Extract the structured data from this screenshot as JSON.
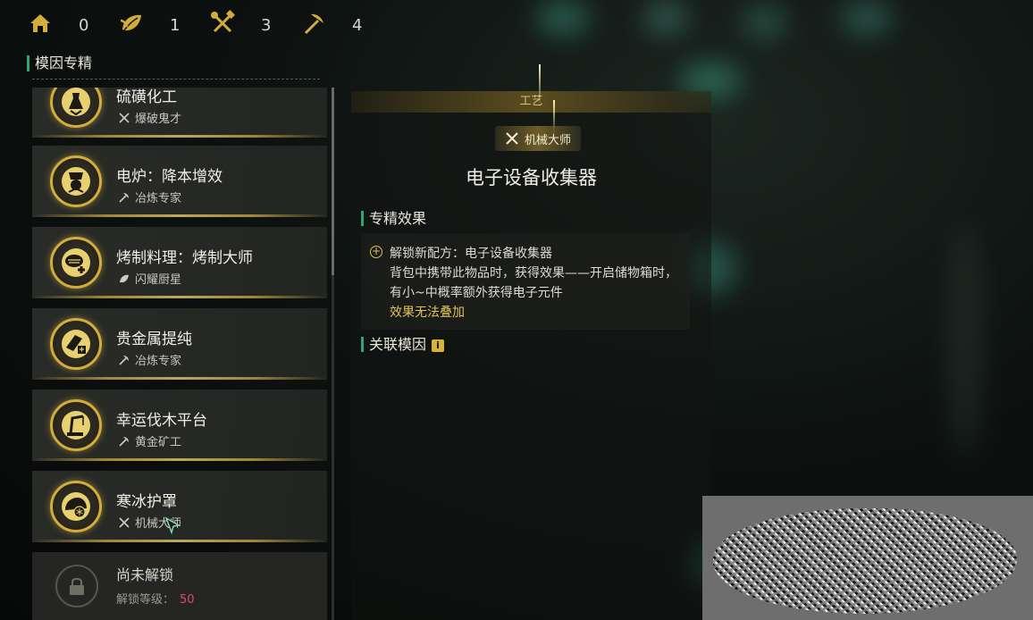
{
  "currencies": [
    {
      "icon": "house-icon",
      "value": "0"
    },
    {
      "icon": "leaf-icon",
      "value": "1"
    },
    {
      "icon": "crossed-tools-icon",
      "value": "3"
    },
    {
      "icon": "pickaxe-icon",
      "value": "4"
    }
  ],
  "panel": {
    "title": "模因专精"
  },
  "items": [
    {
      "name": "硫磺化工",
      "sub": "爆破鬼才",
      "sub_icon": "crossed-tools-icon",
      "icon": "chemical-flask-icon"
    },
    {
      "name": "电炉：降本增效",
      "sub": "冶炼专家",
      "sub_icon": "pickaxe-icon",
      "icon": "furnace-icon"
    },
    {
      "name": "烤制料理：烤制大师",
      "sub": "闪耀厨星",
      "sub_icon": "leaf-icon",
      "icon": "grill-icon"
    },
    {
      "name": "贵金属提纯",
      "sub": "冶炼专家",
      "sub_icon": "pickaxe-icon",
      "icon": "gold-bar-icon"
    },
    {
      "name": "幸运伐木平台",
      "sub": "黄金矿工",
      "sub_icon": "pickaxe-icon",
      "icon": "logging-crane-icon"
    },
    {
      "name": "寒冰护罩",
      "sub": "机械大师",
      "sub_icon": "crossed-tools-icon",
      "icon": "ice-helmet-icon"
    }
  ],
  "locked": {
    "name": "尚未解锁",
    "level_label": "解锁等级：",
    "level_value": "50"
  },
  "detail": {
    "category": "工艺",
    "badge": "机械大师",
    "title": "电子设备收集器",
    "effect_heading": "专精效果",
    "effect_lines": [
      "解锁新配方：电子设备收集器",
      "背包中携带此物品时，获得效果——开启储物箱时，",
      "有小~中概率额外获得电子元件"
    ],
    "effect_warning": "效果无法叠加",
    "related_heading": "关联模因",
    "info_glyph": "i"
  },
  "colors": {
    "accent_green": "#2fa571",
    "gold": "#d3ad3b",
    "warning": "#e2c25a",
    "level_red": "#d64d6a"
  }
}
